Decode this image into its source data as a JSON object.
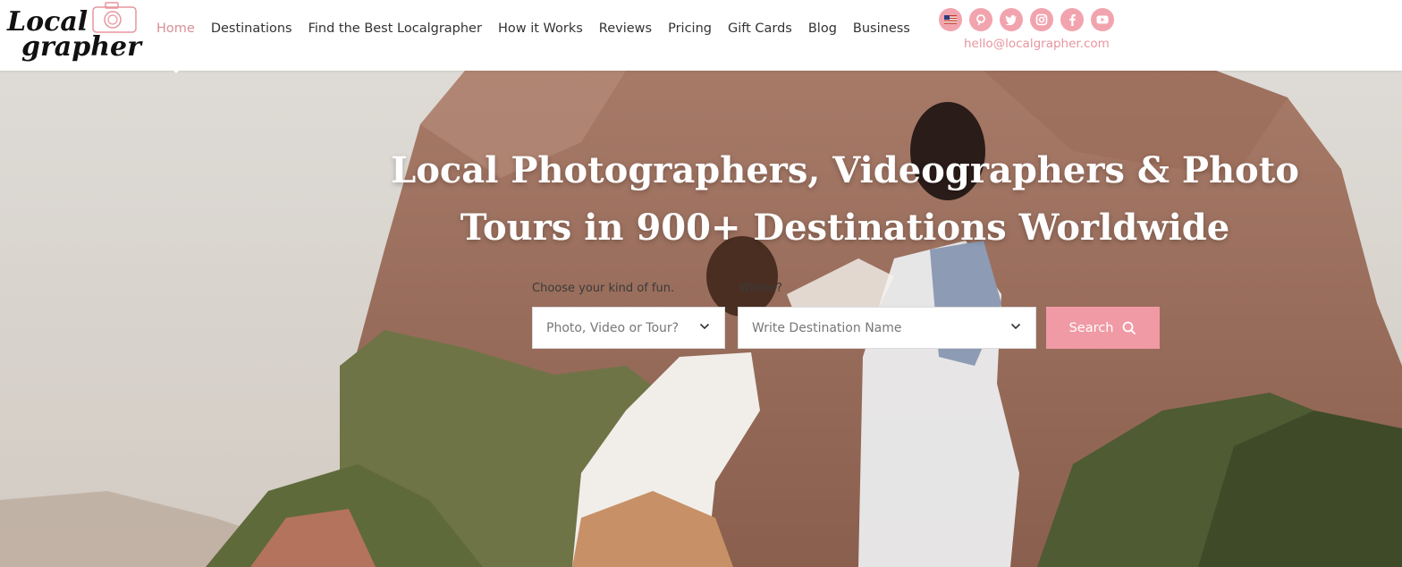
{
  "brand": {
    "logo_line1": "Local",
    "logo_line2": "grapher"
  },
  "nav": {
    "items": [
      {
        "label": "Home",
        "active": true
      },
      {
        "label": "Destinations"
      },
      {
        "label": "Find the Best Localgrapher"
      },
      {
        "label": "How it Works"
      },
      {
        "label": "Reviews"
      },
      {
        "label": "Pricing"
      },
      {
        "label": "Gift Cards"
      },
      {
        "label": "Blog"
      },
      {
        "label": "Business"
      }
    ]
  },
  "social": {
    "icons": [
      "us-flag-icon",
      "pinterest-icon",
      "twitter-icon",
      "instagram-icon",
      "facebook-icon",
      "youtube-icon"
    ],
    "email": "hello@localgrapher.com"
  },
  "hero": {
    "title_line1": "Local Photographers, Videographers & Photo",
    "title_line2": "Tours in 900+ Destinations Worldwide"
  },
  "search": {
    "kind_label": "Choose your kind of fun.",
    "where_label": "Where?",
    "kind_placeholder": "Photo, Video or Tour?",
    "destination_placeholder": "Write Destination Name",
    "button_label": "Search"
  },
  "colors": {
    "accent": "#f09aa5",
    "nav_active": "#d88f96",
    "email": "#e7959e"
  }
}
